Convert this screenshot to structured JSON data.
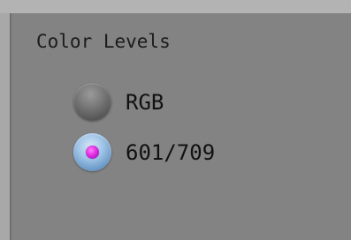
{
  "group": {
    "title": "Color Levels",
    "options": [
      {
        "label": "RGB",
        "selected": false
      },
      {
        "label": "601/709",
        "selected": true
      }
    ]
  },
  "colors": {
    "panel": "#838383",
    "background": "#a8a8a8",
    "selected_radio": "#9ec3e6",
    "selected_dot": "#e02de3"
  }
}
